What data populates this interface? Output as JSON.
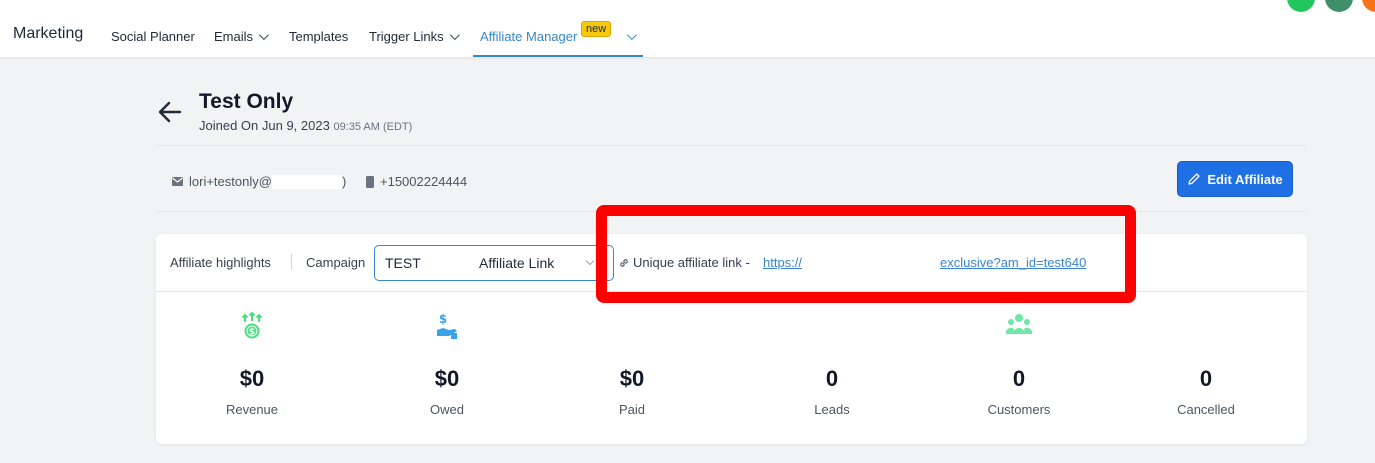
{
  "nav": {
    "brand": "Marketing",
    "items": [
      {
        "label": "Social Planner",
        "dropdown": false
      },
      {
        "label": "Emails",
        "dropdown": true
      },
      {
        "label": "Templates",
        "dropdown": false
      },
      {
        "label": "Trigger Links",
        "dropdown": true
      },
      {
        "label": "Affiliate Manager",
        "dropdown": true,
        "active": true
      }
    ],
    "new_badge": "new"
  },
  "affiliate": {
    "name": "Test Only",
    "joined": "Joined On Jun 9, 2023",
    "joined_time": "09:35 AM (EDT)",
    "email": "lori+testonly@",
    "email_end": ")",
    "phone": "+15002224444",
    "edit_label": "Edit Affiliate"
  },
  "highlights": {
    "label": "Affiliate highlights",
    "campaign_label": "Campaign",
    "campaign_value": "TEST",
    "campaign_type": "Affiliate Link",
    "link_label": "Unique affiliate link -",
    "link_start": "https://",
    "link_end": "exclusive?am_id=test640"
  },
  "stats": [
    {
      "value": "$0",
      "label": "Revenue",
      "icon": "money-growth-icon"
    },
    {
      "value": "$0",
      "label": "Owed",
      "icon": "hand-dollar-icon"
    },
    {
      "value": "$0",
      "label": "Paid",
      "icon": "none"
    },
    {
      "value": "0",
      "label": "Leads",
      "icon": "none"
    },
    {
      "value": "0",
      "label": "Customers",
      "icon": "users-group-icon"
    },
    {
      "value": "0",
      "label": "Cancelled",
      "icon": "none"
    }
  ],
  "colors": {
    "accent": "#3a86c8",
    "primary_button": "#1f6fe5",
    "highlight_box": "#ff0000",
    "badge": "#f6c90e",
    "green_icon": "#4ade80",
    "blue_icon": "#38a4e8"
  }
}
